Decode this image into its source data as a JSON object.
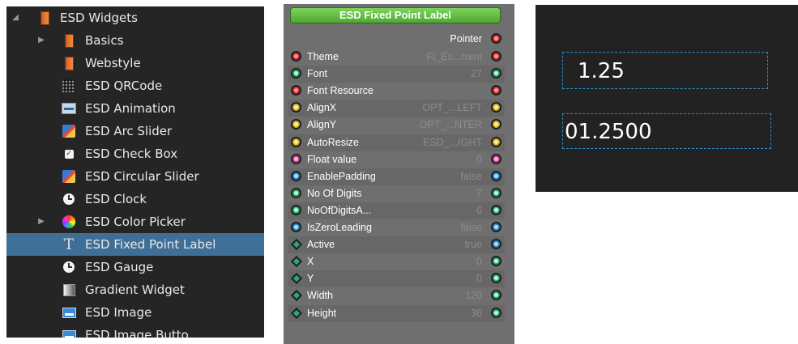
{
  "tree": {
    "items": [
      {
        "label": "ESD Widgets",
        "icon": "folder-book-icon",
        "expander": "expanded"
      },
      {
        "label": "Basics",
        "icon": "folder-book-icon",
        "expander": "collapsed"
      },
      {
        "label": "Webstyle",
        "icon": "folder-book-icon",
        "expander": ""
      },
      {
        "label": "ESD QRCode",
        "icon": "qrcode-icon",
        "expander": ""
      },
      {
        "label": "ESD Animation",
        "icon": "animation-icon",
        "expander": ""
      },
      {
        "label": "ESD Arc Slider",
        "icon": "arc-slider-icon",
        "expander": ""
      },
      {
        "label": "ESD Check Box",
        "icon": "checkbox-icon",
        "expander": ""
      },
      {
        "label": "ESD Circular Slider",
        "icon": "circular-slider-icon",
        "expander": ""
      },
      {
        "label": "ESD Clock",
        "icon": "clock-icon",
        "expander": ""
      },
      {
        "label": "ESD Color Picker",
        "icon": "color-wheel-icon",
        "expander": "collapsed"
      },
      {
        "label": "ESD Fixed Point Label",
        "icon": "text-t-icon",
        "expander": "",
        "selected": true
      },
      {
        "label": "ESD Gauge",
        "icon": "gauge-icon",
        "expander": ""
      },
      {
        "label": "Gradient Widget",
        "icon": "gradient-icon",
        "expander": ""
      },
      {
        "label": "ESD Image",
        "icon": "image-icon",
        "expander": ""
      },
      {
        "label": "ESD Image Butto",
        "icon": "image-button-icon",
        "expander": ""
      }
    ],
    "arrow_expanded": "◢",
    "arrow_collapsed": "▶"
  },
  "props": {
    "title": "ESD Fixed Point Label",
    "pointer_label": "Pointer",
    "rows": [
      {
        "name": "Theme",
        "value": "Ft_Es...rrent",
        "left_port": "red",
        "right_port": "red"
      },
      {
        "name": "Font",
        "value": "27",
        "left_port": "green",
        "right_port": "green"
      },
      {
        "name": "Font Resource",
        "value": "",
        "left_port": "red",
        "right_port": "red"
      },
      {
        "name": "AlignX",
        "value": "OPT_...LEFT",
        "left_port": "yellow",
        "right_port": "yellow"
      },
      {
        "name": "AlignY",
        "value": "OPT_...NTER",
        "left_port": "yellow",
        "right_port": "yellow"
      },
      {
        "name": "AutoResize",
        "value": "ESD_...IGHT",
        "left_port": "yellow",
        "right_port": "yellow"
      },
      {
        "name": "Float value",
        "value": "0",
        "left_port": "pink",
        "right_port": "pink"
      },
      {
        "name": "EnablePadding",
        "value": "false",
        "left_port": "blue",
        "right_port": "blue"
      },
      {
        "name": "No Of Digits",
        "value": "7",
        "left_port": "green",
        "right_port": "green"
      },
      {
        "name": "NoOfDigitsA...",
        "value": "6",
        "left_port": "green",
        "right_port": "green"
      },
      {
        "name": "IsZeroLeading",
        "value": "false",
        "left_port": "blue",
        "right_port": "blue"
      },
      {
        "name": "Active",
        "value": "true",
        "left_port": "diamond",
        "right_port": "blue"
      },
      {
        "name": "X",
        "value": "0",
        "left_port": "diamond",
        "right_port": "green"
      },
      {
        "name": "Y",
        "value": "0",
        "left_port": "diamond",
        "right_port": "green"
      },
      {
        "name": "Width",
        "value": "120",
        "left_port": "diamond",
        "right_port": "green"
      },
      {
        "name": "Height",
        "value": "36",
        "left_port": "diamond",
        "right_port": "green"
      }
    ]
  },
  "preview": {
    "label1": "1.25",
    "label2": "01.2500"
  },
  "colors": {
    "selection": "#3f6f97",
    "tree_bg": "#252526",
    "panel_bg": "#6f6f6f",
    "title_green": "#4fa833",
    "preview_bg": "#222222",
    "dashed_border": "#2d8ec8"
  }
}
